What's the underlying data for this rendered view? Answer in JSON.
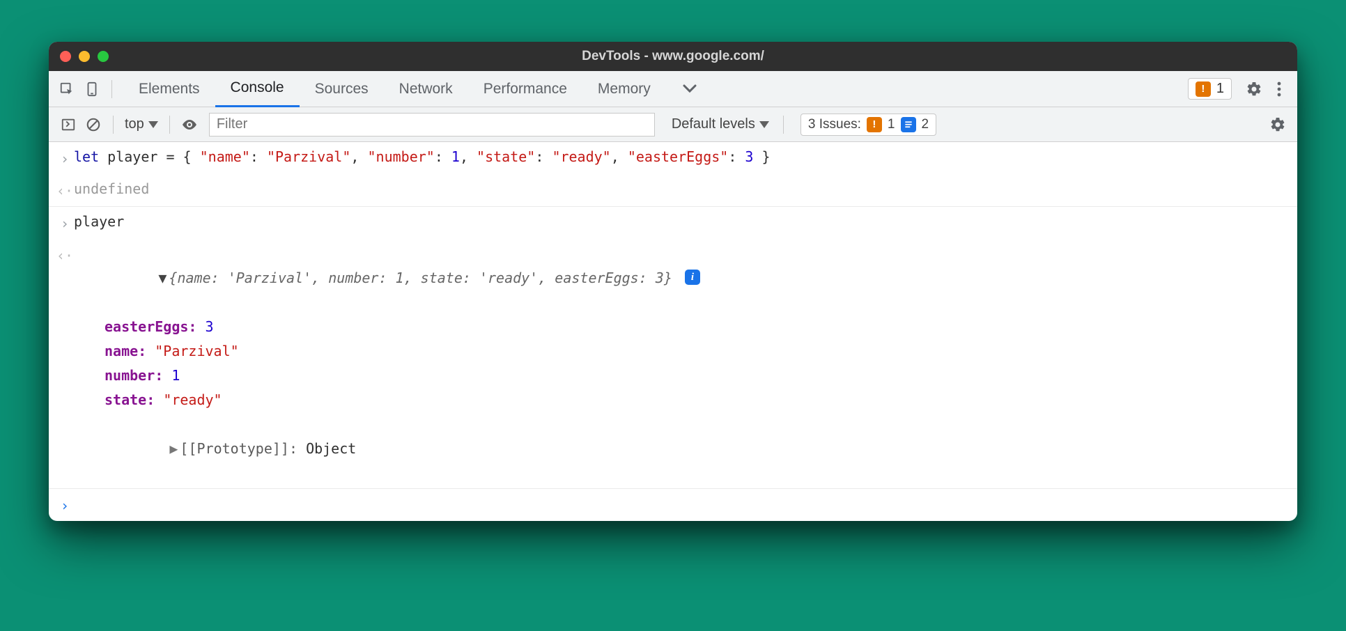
{
  "window": {
    "title": "DevTools - www.google.com/"
  },
  "tabs": {
    "items": [
      "Elements",
      "Console",
      "Sources",
      "Network",
      "Performance",
      "Memory"
    ],
    "active": "Console",
    "warning_count": "1"
  },
  "consolebar": {
    "context": "top",
    "filter_placeholder": "Filter",
    "levels_label": "Default levels",
    "issues": {
      "label_prefix": "3 Issues:",
      "warn": "1",
      "info": "2"
    }
  },
  "log": {
    "line1": {
      "prefix": "let ",
      "var": "player",
      "equals": " = { ",
      "pairs": [
        {
          "key": "\"name\"",
          "val": "\"Parzival\"",
          "type": "str"
        },
        {
          "key": "\"number\"",
          "val": "1",
          "type": "num"
        },
        {
          "key": "\"state\"",
          "val": "\"ready\"",
          "type": "str"
        },
        {
          "key": "\"easterEggs\"",
          "val": "3",
          "type": "num"
        }
      ],
      "close": " }"
    },
    "line2": "undefined",
    "line3": "player",
    "expanded": {
      "summary": "{name: 'Parzival', number: 1, state: 'ready', easterEggs: 3}",
      "props": [
        {
          "key": "easterEggs",
          "val": "3",
          "type": "num"
        },
        {
          "key": "name",
          "val": "\"Parzival\"",
          "type": "str"
        },
        {
          "key": "number",
          "val": "1",
          "type": "num"
        },
        {
          "key": "state",
          "val": "\"ready\"",
          "type": "str"
        }
      ],
      "proto_label": "[[Prototype]]",
      "proto_value": "Object"
    }
  }
}
